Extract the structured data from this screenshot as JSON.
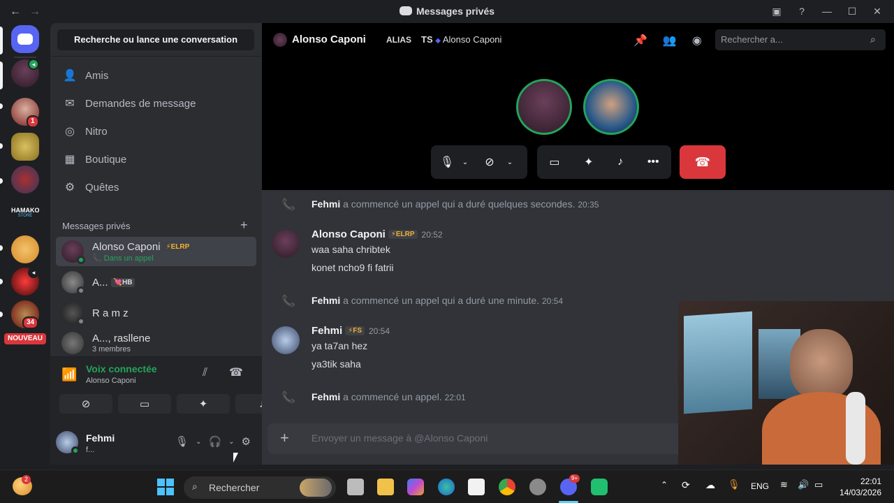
{
  "window": {
    "title": "Messages privés"
  },
  "rail": {
    "nouveau": "NOUVEAU",
    "badge_unread": "1",
    "badge_34": "34",
    "hamako_title": "HAMAKO",
    "hamako_sub": "STORE"
  },
  "sidebar": {
    "search_label": "Recherche ou lance une conversation",
    "nav": [
      {
        "label": "Amis",
        "icon": "friends-icon"
      },
      {
        "label": "Demandes de message",
        "icon": "mail-icon"
      },
      {
        "label": "Nitro",
        "icon": "nitro-icon"
      },
      {
        "label": "Boutique",
        "icon": "shop-icon"
      },
      {
        "label": "Quêtes",
        "icon": "quests-icon"
      }
    ],
    "dm_header": "Messages privés",
    "dms": [
      {
        "name": "Alonso Caponi",
        "tag": "⚡ELRP",
        "sub": "📞 Dans un appel",
        "status": "#23a55a"
      },
      {
        "name": "A...",
        "tag": "💘HB",
        "sub": "",
        "status": "#80848e"
      },
      {
        "name": "R a m z",
        "tag": "",
        "sub": "",
        "status": "#80848e"
      },
      {
        "name": "A..., rasllene",
        "tag": "",
        "sub": "3 membres",
        "status": ""
      }
    ],
    "voice": {
      "title": "Voix connectée",
      "subtitle": "Alonso Caponi"
    },
    "user": {
      "name": "Fehmi",
      "status": "f..."
    }
  },
  "call_header": {
    "name": "Alonso Caponi",
    "alias": "ALIAS",
    "ts": "TS",
    "ts_name": "Alonso Caponi",
    "search_placeholder": "Rechercher a..."
  },
  "messages": {
    "sys1": {
      "name": "Fehmi",
      "text": " a commencé un appel qui a duré quelques secondes.",
      "time": "20:35"
    },
    "m1": {
      "name": "Alonso Caponi",
      "tag": "⚡ELRP",
      "time": "20:52",
      "lines": [
        "waa saha chribtek",
        "konet ncho9 fi fatrii"
      ]
    },
    "sys2": {
      "name": "Fehmi",
      "text": " a commencé un appel qui a duré une minute.",
      "time": "20:54"
    },
    "m2": {
      "name": "Fehmi",
      "tag": "⚡FS",
      "time": "20:54",
      "lines": [
        "ya ta7an hez",
        "ya3tik saha"
      ]
    },
    "sys3": {
      "name": "Fehmi",
      "text": " a commencé un appel.",
      "time": "22:01"
    }
  },
  "composer": {
    "placeholder": "Envoyer un message à @Alonso Caponi"
  },
  "taskbar": {
    "search": "Rechercher",
    "lang": "ENG",
    "time": "22:01",
    "date": "14/03/2026",
    "weather_badge": "2",
    "discord_badge": "9+"
  },
  "colors": {
    "accent_green": "#23a55a",
    "hangup_red": "#da373c",
    "brand": "#5865f2"
  }
}
